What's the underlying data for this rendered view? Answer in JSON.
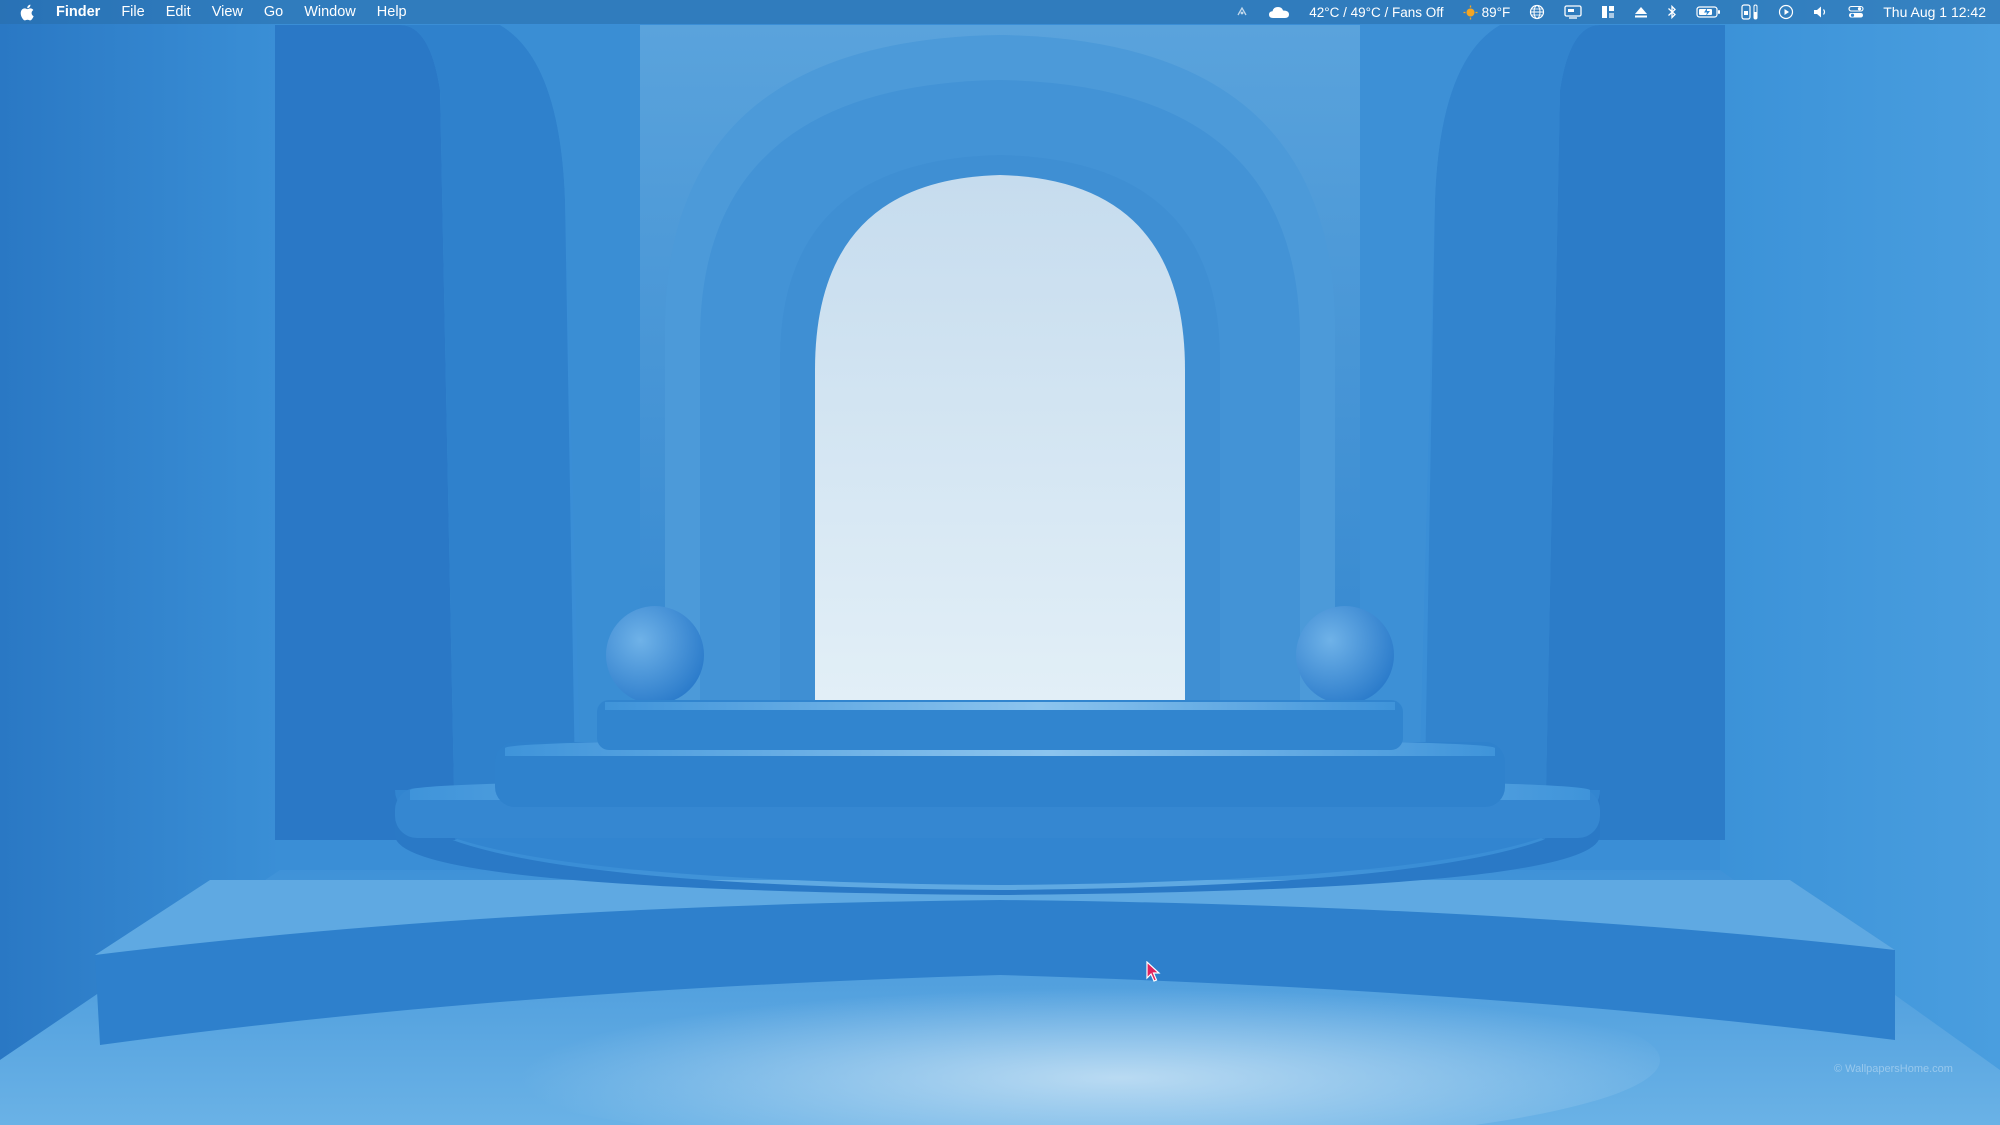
{
  "menubar": {
    "apple_icon": "apple-logo-icon",
    "app_name": "Finder",
    "menus": [
      "File",
      "Edit",
      "View",
      "Go",
      "Window",
      "Help"
    ],
    "status": {
      "icons": [
        "snippets-icon",
        "cloud-icon",
        "sun-icon",
        "globe-icon",
        "display-icon",
        "layout-icon",
        "eject-icon",
        "bluetooth-icon",
        "battery-icon",
        "phone-battery-icon",
        "play-icon",
        "volume-icon",
        "control-center-icon"
      ],
      "fan_status": "42°C / 49°C / Fans Off",
      "weather_temp": "89°F",
      "datetime": "Thu Aug 1  12:42"
    }
  },
  "wallpaper": {
    "watermark": "© WallpapersHome.com",
    "colors": {
      "base": "#2f86d0",
      "deep": "#1f6fc0",
      "light": "#cfe4f2",
      "floor": "#5aa6e0"
    }
  },
  "cursor": {
    "color": "#e0245e"
  }
}
